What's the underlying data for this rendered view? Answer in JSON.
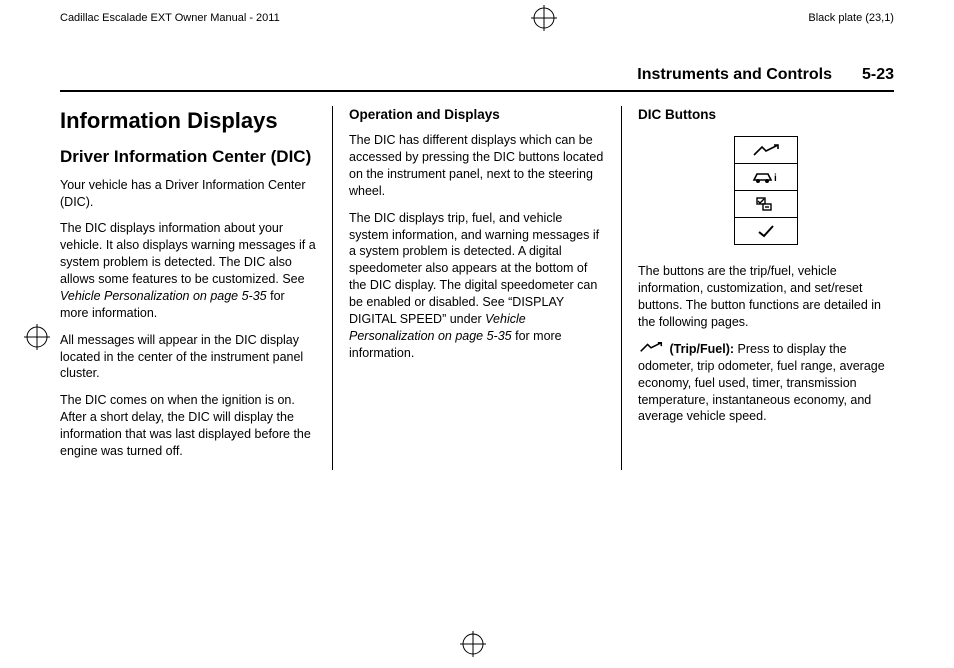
{
  "meta": {
    "doc_title": "Cadillac Escalade EXT Owner Manual - 2011",
    "plate": "Black plate (23,1)"
  },
  "header": {
    "section": "Instruments and Controls",
    "page": "5-23"
  },
  "col1": {
    "h1": "Information Displays",
    "h2": "Driver Information Center (DIC)",
    "p1": "Your vehicle has a Driver Information Center (DIC).",
    "p2a": "The DIC displays information about your vehicle. It also displays warning messages if a system problem is detected. The DIC also allows some features to be customized. See ",
    "p2b": "Vehicle Personalization on page 5‑35",
    "p2c": " for more information.",
    "p3": "All messages will appear in the DIC display located in the center of the instrument panel cluster.",
    "p4": "The DIC comes on when the ignition is on. After a short delay, the DIC will display the information that was last displayed before the engine was turned off."
  },
  "col2": {
    "h3": "Operation and Displays",
    "p1": "The DIC has different displays which can be accessed by pressing the DIC buttons located on the instrument panel, next to the steering wheel.",
    "p2a": "The DIC displays trip, fuel, and vehicle system information, and warning messages if a system problem is detected. A digital speedometer also appears at the bottom of the DIC display. The digital speedometer can be enabled or disabled. See “DISPLAY DIGITAL SPEED” under ",
    "p2b": "Vehicle Personalization on page 5‑35",
    "p2c": " for more information."
  },
  "col3": {
    "h3": "DIC Buttons",
    "p1": "The buttons are the trip/fuel, vehicle information, customization, and set/reset buttons. The button functions are detailed in the following pages.",
    "tf_label": " (Trip/Fuel): ",
    "tf_body": " Press to display the odometer, trip odometer, fuel range, average economy, fuel used, timer, transmission temperature, instantaneous economy, and average vehicle speed."
  }
}
